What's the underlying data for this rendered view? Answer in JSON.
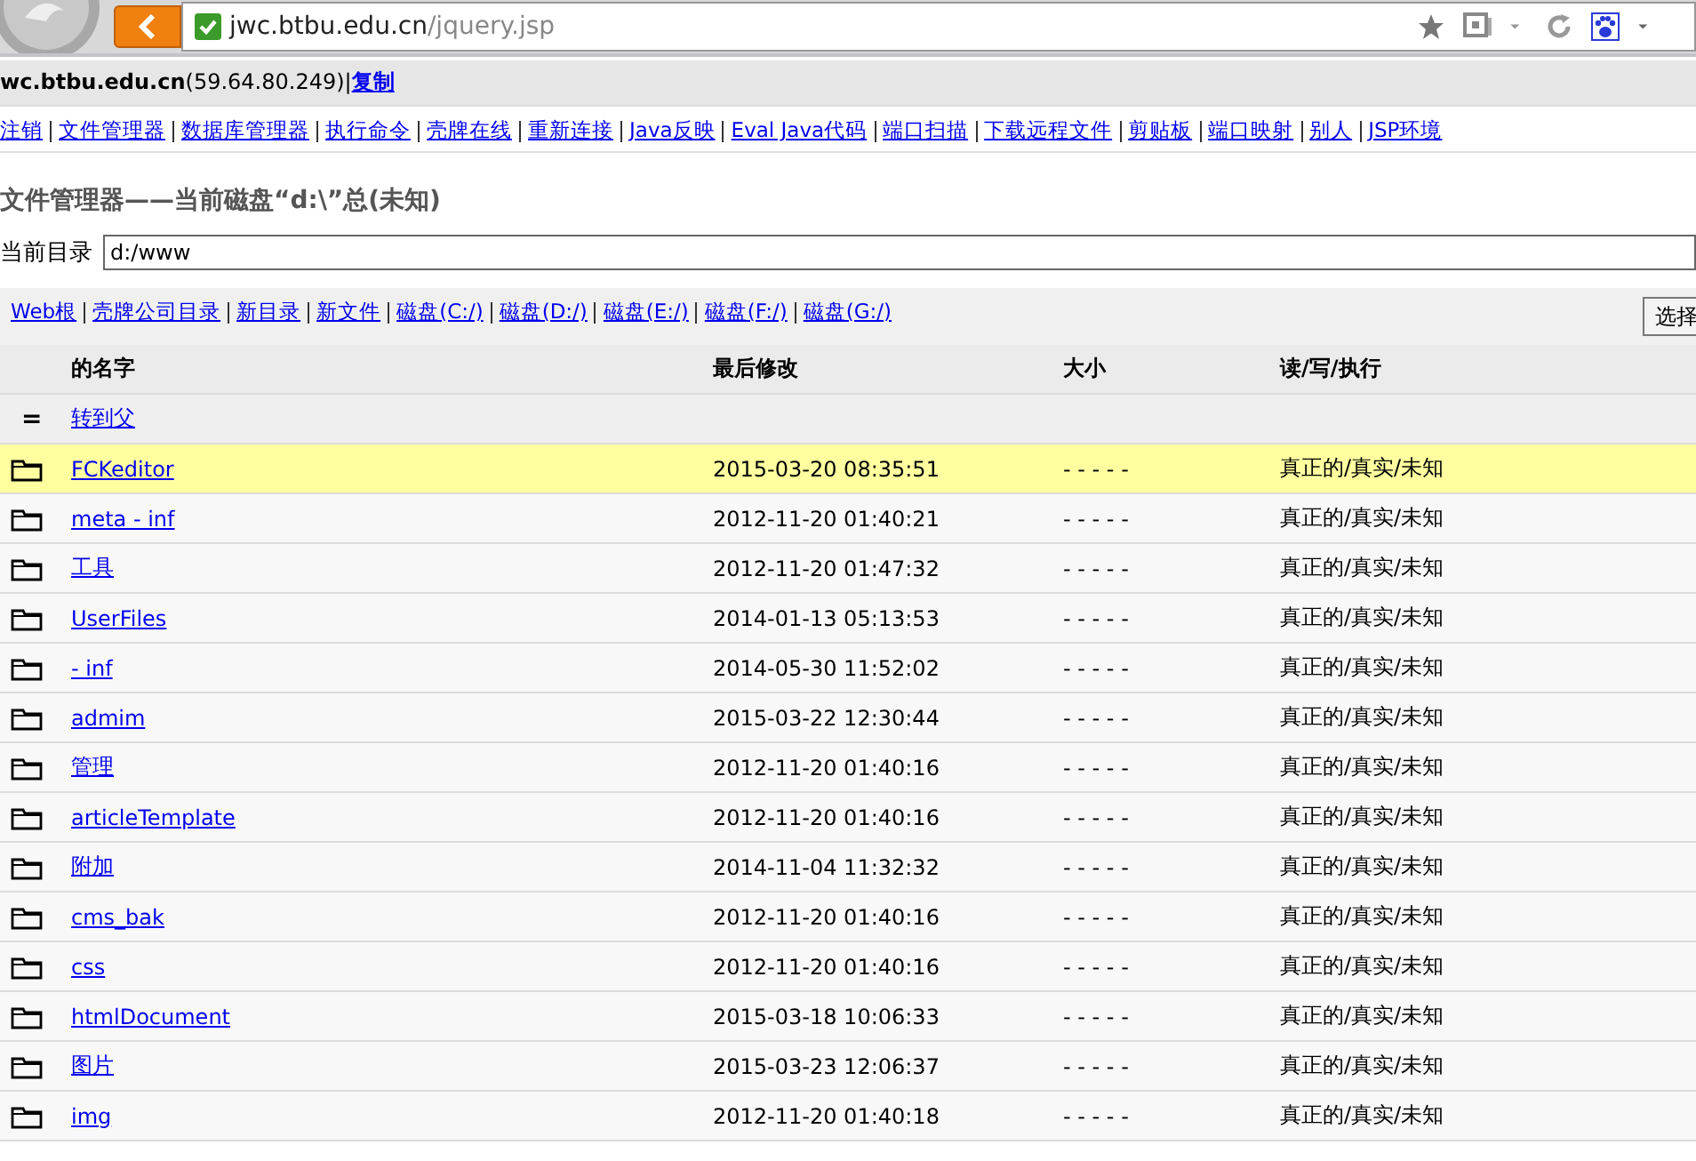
{
  "browser": {
    "secure": true,
    "url_host": "jwc.btbu.edu.cn",
    "url_path": "/jquery.jsp"
  },
  "host_line": {
    "host": "wc.btbu.edu.cn",
    "ip": "(59.64.80.249)|",
    "copy_link": "复制"
  },
  "nav_links": [
    "注销",
    "文件管理器",
    "数据库管理器",
    "执行命令",
    "壳牌在线",
    "重新连接",
    "Java反映",
    "Eval Java代码",
    "端口扫描",
    "下载远程文件",
    "剪贴板",
    "端口映射",
    "别人",
    "JSP环境"
  ],
  "title": "文件管理器——当前磁盘“d:\\”总(未知)",
  "current_dir": {
    "label": "当前目录",
    "value": "d:/www"
  },
  "toolbar_links": [
    "Web根",
    "壳牌公司目录",
    "新目录",
    "新文件",
    "磁盘(C:/)",
    "磁盘(D:/)",
    "磁盘(E:/)",
    "磁盘(F:/)",
    "磁盘(G:/)"
  ],
  "select_button": "选择",
  "table": {
    "columns": [
      "的名字",
      "最后修改",
      "大小",
      "读/写/执行"
    ],
    "parent_row": {
      "symbol": "=",
      "link": "转到父"
    },
    "rows": [
      {
        "name": "FCKeditor",
        "modified": "2015-03-20 08:35:51",
        "size": "- - - - -",
        "permissions": "真正的/真实/未知",
        "highlighted": true
      },
      {
        "name": "meta - inf",
        "modified": "2012-11-20 01:40:21",
        "size": "- - - - -",
        "permissions": "真正的/真实/未知",
        "highlighted": false
      },
      {
        "name": "工具",
        "modified": "2012-11-20 01:47:32",
        "size": "- - - - -",
        "permissions": "真正的/真实/未知",
        "highlighted": false
      },
      {
        "name": "UserFiles",
        "modified": "2014-01-13 05:13:53",
        "size": "- - - - -",
        "permissions": "真正的/真实/未知",
        "highlighted": false
      },
      {
        "name": "- inf",
        "modified": "2014-05-30 11:52:02",
        "size": "- - - - -",
        "permissions": "真正的/真实/未知",
        "highlighted": false
      },
      {
        "name": "admim",
        "modified": "2015-03-22 12:30:44",
        "size": "- - - - -",
        "permissions": "真正的/真实/未知",
        "highlighted": false
      },
      {
        "name": "管理",
        "modified": "2012-11-20 01:40:16",
        "size": "- - - - -",
        "permissions": "真正的/真实/未知",
        "highlighted": false
      },
      {
        "name": "articleTemplate",
        "modified": "2012-11-20 01:40:16",
        "size": "- - - - -",
        "permissions": "真正的/真实/未知",
        "highlighted": false
      },
      {
        "name": "附加",
        "modified": "2014-11-04 11:32:32",
        "size": "- - - - -",
        "permissions": "真正的/真实/未知",
        "highlighted": false
      },
      {
        "name": "cms_bak",
        "modified": "2012-11-20 01:40:16",
        "size": "- - - - -",
        "permissions": "真正的/真实/未知",
        "highlighted": false
      },
      {
        "name": "css",
        "modified": "2012-11-20 01:40:16",
        "size": "- - - - -",
        "permissions": "真正的/真实/未知",
        "highlighted": false
      },
      {
        "name": "htmlDocument",
        "modified": "2015-03-18 10:06:33",
        "size": "- - - - -",
        "permissions": "真正的/真实/未知",
        "highlighted": false
      },
      {
        "name": "图片",
        "modified": "2015-03-23 12:06:37",
        "size": "- - - - -",
        "permissions": "真正的/真实/未知",
        "highlighted": false
      },
      {
        "name": "img",
        "modified": "2012-11-20 01:40:18",
        "size": "- - - - -",
        "permissions": "真正的/真实/未知",
        "highlighted": false
      }
    ]
  }
}
